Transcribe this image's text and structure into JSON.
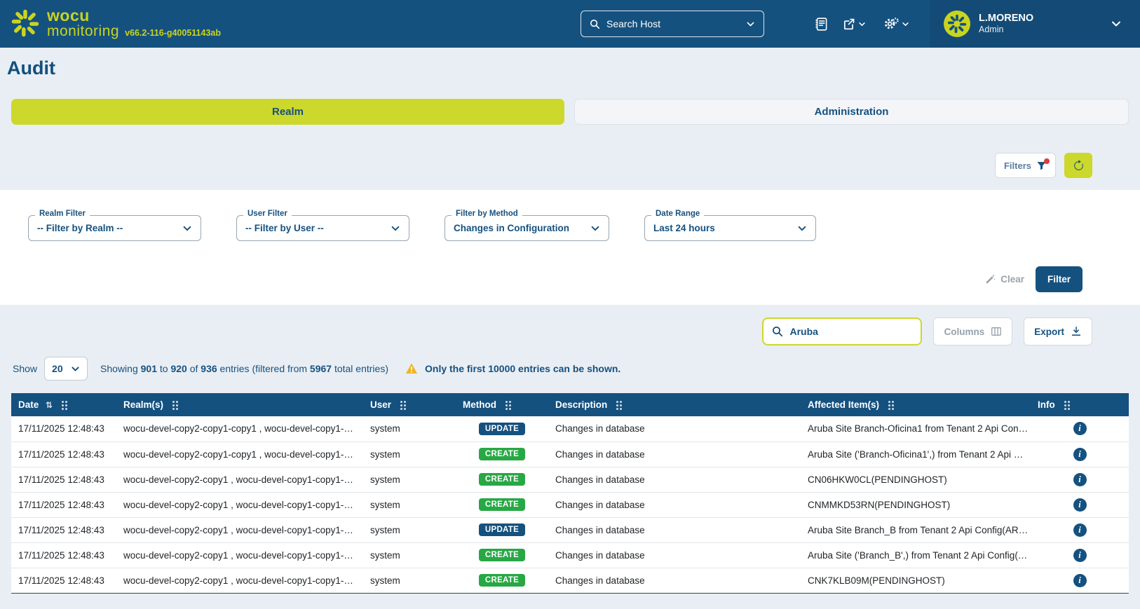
{
  "navbar": {
    "brand_line1": "wocu",
    "brand_line2": "monitoring",
    "version": "v66.2-116-g40051143ab",
    "search_value": "Search Host",
    "user_name": "L.MORENO",
    "user_role": "Admin"
  },
  "page_title": "Audit",
  "tabs": {
    "realm": "Realm",
    "administration": "Administration"
  },
  "toolbar": {
    "filters_label": "Filters"
  },
  "filter_panel": {
    "fields": [
      {
        "label": "Realm Filter",
        "value": "-- Filter by Realm --"
      },
      {
        "label": "User Filter",
        "value": "-- Filter by User --"
      },
      {
        "label": "Filter by Method",
        "value": "Changes in Configuration"
      },
      {
        "label": "Date Range",
        "value": "Last 24 hours"
      }
    ],
    "clear_label": "Clear",
    "filter_label": "Filter"
  },
  "table_controls": {
    "search_value": "Aruba",
    "columns_label": "Columns",
    "export_label": "Export"
  },
  "info_bar": {
    "show_label": "Show",
    "page_size": "20",
    "summary_parts": [
      "Showing ",
      "901",
      " to ",
      "920",
      " of ",
      "936",
      " entries (filtered from ",
      "5967",
      " total entries)"
    ],
    "warning": "Only the first 10000 entries can be shown."
  },
  "table": {
    "columns": [
      "Date",
      "Realm(s)",
      "User",
      "Method",
      "Description",
      "Affected Item(s)",
      "Info"
    ],
    "rows": [
      {
        "date": "17/11/2025 12:48:43",
        "realms": "wocu-devel-copy2-copy1-copy1 , wocu-devel-copy1-…",
        "user": "system",
        "method": "UPDATE",
        "description": "Changes in database",
        "affected": "Aruba Site Branch-Oficina1 from Tenant 2 Api Con…"
      },
      {
        "date": "17/11/2025 12:48:43",
        "realms": "wocu-devel-copy2-copy1-copy1 , wocu-devel-copy1-…",
        "user": "system",
        "method": "CREATE",
        "description": "Changes in database",
        "affected": "Aruba Site ('Branch-Oficina1',) from Tenant 2 Api …"
      },
      {
        "date": "17/11/2025 12:48:43",
        "realms": "wocu-devel-copy2-copy1 , wocu-devel-copy1-copy1-…",
        "user": "system",
        "method": "CREATE",
        "description": "Changes in database",
        "affected": "CN06HKW0CL(PENDINGHOST)"
      },
      {
        "date": "17/11/2025 12:48:43",
        "realms": "wocu-devel-copy2-copy1 , wocu-devel-copy1-copy1-…",
        "user": "system",
        "method": "CREATE",
        "description": "Changes in database",
        "affected": "CNMMKD53RN(PENDINGHOST)"
      },
      {
        "date": "17/11/2025 12:48:43",
        "realms": "wocu-devel-copy2-copy1 , wocu-devel-copy1-copy1-…",
        "user": "system",
        "method": "UPDATE",
        "description": "Changes in database",
        "affected": "Aruba Site Branch_B from Tenant 2 Api Config(AR…"
      },
      {
        "date": "17/11/2025 12:48:43",
        "realms": "wocu-devel-copy2-copy1 , wocu-devel-copy1-copy1-…",
        "user": "system",
        "method": "CREATE",
        "description": "Changes in database",
        "affected": "Aruba Site ('Branch_B',) from Tenant 2 Api Config(…"
      },
      {
        "date": "17/11/2025 12:48:43",
        "realms": "wocu-devel-copy2-copy1 , wocu-devel-copy1-copy1-…",
        "user": "system",
        "method": "CREATE",
        "description": "Changes in database",
        "affected": "CNK7KLB09M(PENDINGHOST)"
      }
    ]
  },
  "colors": {
    "navy": "#15517f",
    "chartreuse": "#ccd82b",
    "create_green": "#28a745",
    "update_blue": "#15517f",
    "warning_amber": "#f0b429",
    "alert_red": "#e53935"
  }
}
